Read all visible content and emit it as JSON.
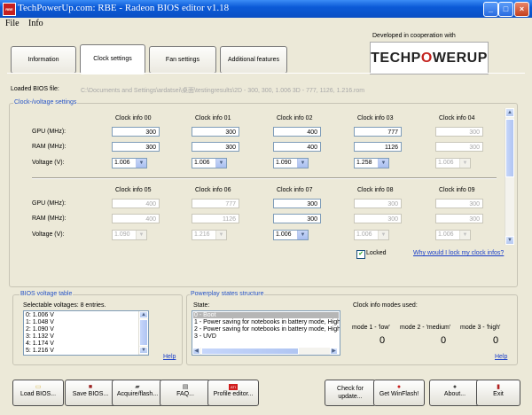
{
  "window": {
    "title": "TechPowerUp.com: RBE - Radeon BIOS editor v1.18",
    "app_icon": "RBE",
    "min_glyph": "_",
    "max_glyph": "□",
    "close_glyph": "×"
  },
  "menu": [
    {
      "label": "File",
      "access_key": "F"
    },
    {
      "label": "Info",
      "access_key": "I"
    }
  ],
  "tabs": [
    {
      "label": "Information",
      "active": false
    },
    {
      "label": "Clock settings",
      "active": true
    },
    {
      "label": "Fan settings",
      "active": false
    },
    {
      "label": "Additional features",
      "active": false
    }
  ],
  "cooperation_text": "Developed in cooperation with",
  "logo": {
    "part1": "TECHP",
    "part2": "O",
    "part3": "WERUP"
  },
  "loaded_bios": {
    "label": "Loaded BIOS file:",
    "path": "C:\\Documents and Settings\\ardatsei\\桌面\\testingresults\\2D - 300, 300, 1.006 3D - 777, 1126, 1.216.rom"
  },
  "clock_group": {
    "title": "Clock-/voltage settings",
    "row_labels": {
      "gpu": "GPU (MHz):",
      "ram": "RAM (MHz):",
      "voltage": "Voltage (V):"
    },
    "top": [
      {
        "name": "Clock info 00",
        "gpu": "300",
        "ram": "300",
        "voltage": "1.006",
        "enabled": true
      },
      {
        "name": "Clock info 01",
        "gpu": "300",
        "ram": "300",
        "voltage": "1.006",
        "enabled": true
      },
      {
        "name": "Clock info 02",
        "gpu": "400",
        "ram": "400",
        "voltage": "1.090",
        "enabled": true
      },
      {
        "name": "Clock info 03",
        "gpu": "777",
        "ram": "1126",
        "voltage": "1.258",
        "enabled": true
      },
      {
        "name": "Clock info 04",
        "gpu": "300",
        "ram": "300",
        "voltage": "1.006",
        "enabled": false
      }
    ],
    "bottom": [
      {
        "name": "Clock info 05",
        "gpu": "400",
        "ram": "400",
        "voltage": "1.090",
        "enabled": false
      },
      {
        "name": "Clock info 06",
        "gpu": "777",
        "ram": "1126",
        "voltage": "1.216",
        "enabled": false
      },
      {
        "name": "Clock info 07",
        "gpu": "300",
        "ram": "300",
        "voltage": "1.006",
        "enabled": true
      },
      {
        "name": "Clock info 08",
        "gpu": "300",
        "ram": "300",
        "voltage": "1.006",
        "enabled": false
      },
      {
        "name": "Clock info 09",
        "gpu": "300",
        "ram": "300",
        "voltage": "1.006",
        "enabled": false
      }
    ],
    "locked_label": "Locked",
    "locked_checked": true,
    "why_lock_link": "Why would I lock my clock infos?",
    "scroll_up": "▲",
    "scroll_down": "▼"
  },
  "voltage_table": {
    "title": "BIOS voltage table",
    "entries_label": "Selectable voltages: 8 entries.",
    "items": [
      "0: 1.006 V",
      "1: 1.048 V",
      "2: 1.090 V",
      "3: 1.132 V",
      "4: 1.174 V",
      "5: 1.216 V"
    ],
    "help": "Help"
  },
  "powerplay": {
    "title": "Powerplay states structure",
    "state_label": "State:",
    "states": [
      "0 - Boot",
      "1 - Power saving for notebooks in battery mode, High p",
      "2 - Power saving for notebooks in battery mode, High p",
      "3 - UVD"
    ],
    "selected_state": 0,
    "modes_label": "Clock info modes used:",
    "modes": [
      {
        "label": "mode 1 - 'low'",
        "value": "0"
      },
      {
        "label": "mode 2 - 'medium'",
        "value": "0"
      },
      {
        "label": "mode 3 - 'high'",
        "value": "0"
      }
    ],
    "help": "Help"
  },
  "buttons": [
    {
      "label": "Load BIOS...",
      "icon": "folder-icon",
      "glyph": "▭",
      "color": "#d8b84a"
    },
    {
      "label": "Save BIOS...",
      "icon": "floppy-icon",
      "glyph": "■",
      "color": "#9a1f1f"
    },
    {
      "label": "Acquire/flash...",
      "icon": "chip-icon",
      "glyph": "▰",
      "color": "#555555"
    },
    {
      "label": "FAQ...",
      "icon": "document-icon",
      "glyph": "▤",
      "color": "#333333"
    },
    {
      "label": "Profile editor...",
      "icon": "ati-icon",
      "glyph": "ATI",
      "color": "#d11d1d"
    },
    {
      "label": "Check for update...",
      "icon": "",
      "glyph": "",
      "color": ""
    },
    {
      "label": "Get WinFlash!",
      "icon": "winflash-icon",
      "glyph": "●",
      "color": "#c82020"
    },
    {
      "label": "About...",
      "icon": "info-icon",
      "glyph": "●",
      "color": "#444444"
    },
    {
      "label": "Exit",
      "icon": "exit-icon",
      "glyph": "▮",
      "color": "#b02020"
    }
  ]
}
